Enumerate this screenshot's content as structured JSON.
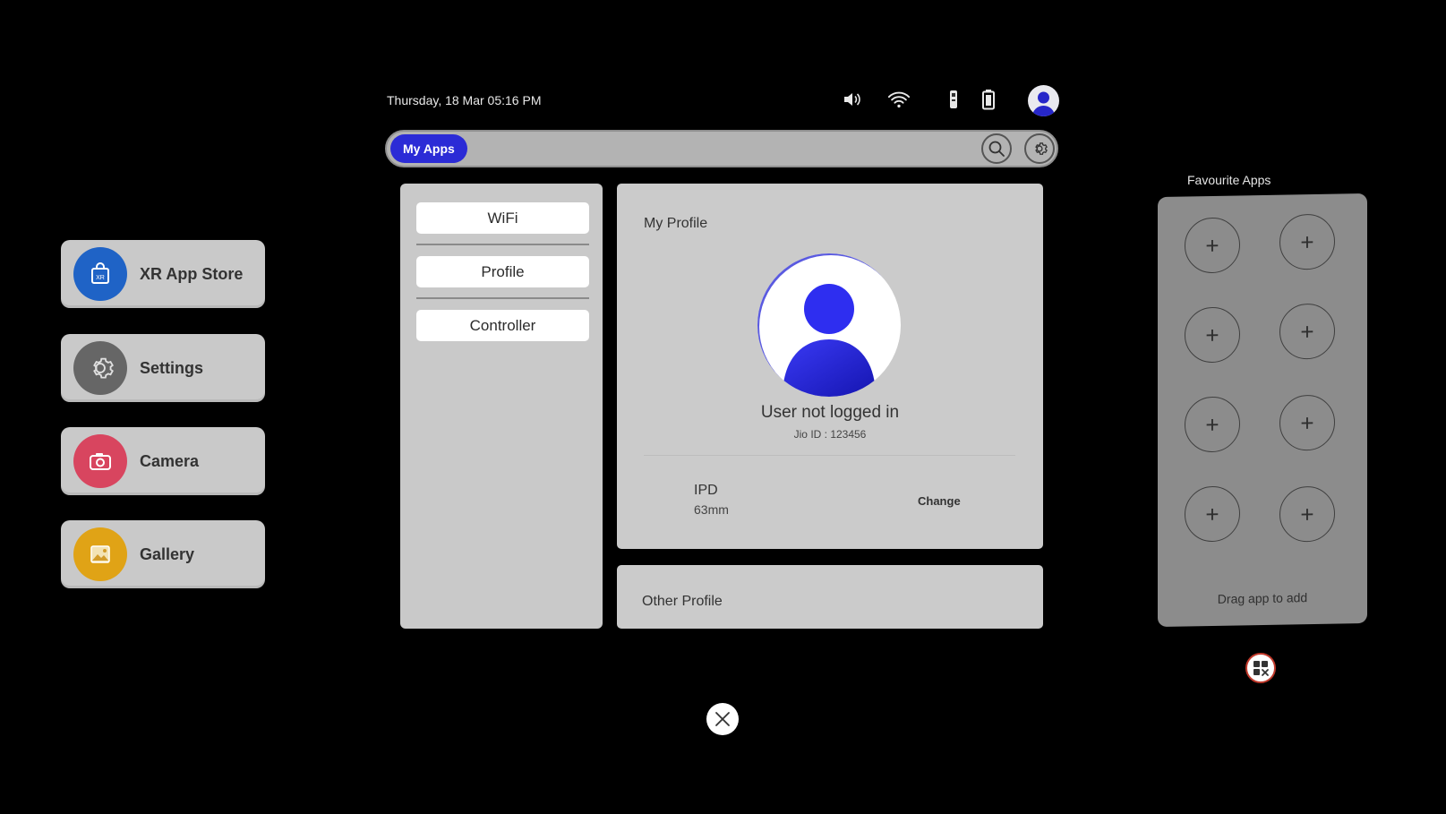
{
  "status_bar": {
    "datetime": "Thursday, 18 Mar 05:16 PM",
    "icons": [
      "speaker-icon",
      "wifi-icon",
      "controller-icon",
      "battery-icon",
      "avatar-icon"
    ]
  },
  "top_bar": {
    "my_apps_label": "My Apps",
    "search_icon": "search-icon",
    "settings_icon": "gear-icon"
  },
  "launcher": {
    "items": [
      {
        "label": "XR App Store",
        "icon": "xr-store-icon",
        "color": "#1f63c6"
      },
      {
        "label": "Settings",
        "icon": "settings-gear-icon",
        "color": "#666666"
      },
      {
        "label": "Camera",
        "icon": "camera-icon",
        "color": "#d8455f"
      },
      {
        "label": "Gallery",
        "icon": "gallery-icon",
        "color": "#e0a316"
      }
    ]
  },
  "settings_menu": {
    "items": [
      "WiFi",
      "Profile",
      "Controller"
    ]
  },
  "profile": {
    "title": "My Profile",
    "user_status": "User not logged in",
    "jio_id": "Jio ID : 123456",
    "ipd_label": "IPD",
    "ipd_value": "63mm",
    "change_label": "Change",
    "other_title": "Other Profile"
  },
  "favourites": {
    "title": "Favourite Apps",
    "hint": "Drag app to add",
    "slot_count": 8
  },
  "colors": {
    "accent": "#2b2bd6",
    "panel": "#cbcbcb",
    "background": "#000000"
  }
}
